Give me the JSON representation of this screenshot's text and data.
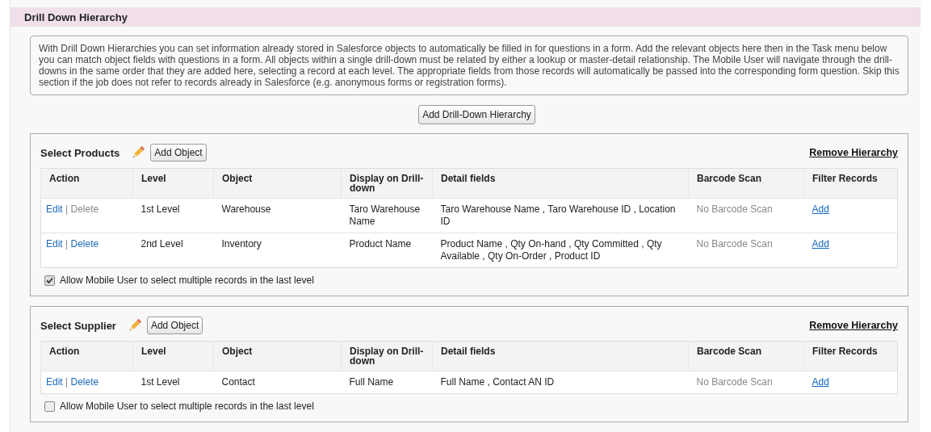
{
  "section": {
    "title": "Drill Down Hierarchy"
  },
  "description": "With Drill Down Hierarchies you can set information already stored in Salesforce objects to automatically be filled in for questions in a form. Add the relevant objects here then in the Task menu below you can match object fields with questions in a form. All objects within a single drill-down must be related by either a lookup or master-detail relationship. The Mobile User will navigate through the drill-downs in the same order that they are added here, selecting a record at each level. The appropriate fields from those records will automatically be passed into the corresponding form question. Skip this section if the job does not refer to records already in Salesforce (e.g. anonymous forms or registration forms).",
  "add_button": "Add Drill-Down Hierarchy",
  "hierarchies": [
    {
      "name": "Select Products",
      "add_object": "Add Object",
      "remove": "Remove Hierarchy",
      "columns": [
        "Action",
        "Level",
        "Object",
        "Display on Drill-down",
        "Detail fields",
        "Barcode Scan",
        "Filter Records"
      ],
      "rows": [
        {
          "edit": "Edit",
          "separator": "|",
          "delete": "Delete",
          "delete_disabled": true,
          "level": "1st Level",
          "object": "Warehouse",
          "display": "Taro Warehouse Name",
          "detail": "Taro Warehouse Name , Taro Warehouse ID , Location ID",
          "barcode": "No Barcode Scan",
          "filter": "Add"
        },
        {
          "edit": "Edit",
          "separator": "|",
          "delete": "Delete",
          "delete_disabled": false,
          "level": "2nd Level",
          "object": "Inventory",
          "display": "Product Name",
          "detail": "Product Name , Qty On-hand , Qty Committed , Qty Available , Qty On-Order , Product ID",
          "barcode": "No Barcode Scan",
          "filter": "Add"
        }
      ],
      "allow_multiple": {
        "label": "Allow Mobile User to select multiple records in the last level",
        "checked": true
      }
    },
    {
      "name": "Select Supplier",
      "add_object": "Add Object",
      "remove": "Remove Hierarchy",
      "columns": [
        "Action",
        "Level",
        "Object",
        "Display on Drill-down",
        "Detail fields",
        "Barcode Scan",
        "Filter Records"
      ],
      "rows": [
        {
          "edit": "Edit",
          "separator": "|",
          "delete": "Delete",
          "delete_disabled": false,
          "level": "1st Level",
          "object": "Contact",
          "display": "Full Name",
          "detail": "Full Name , Contact AN ID",
          "barcode": "No Barcode Scan",
          "filter": "Add"
        }
      ],
      "allow_multiple": {
        "label": "Allow Mobile User to select multiple records in the last level",
        "checked": false
      }
    }
  ]
}
